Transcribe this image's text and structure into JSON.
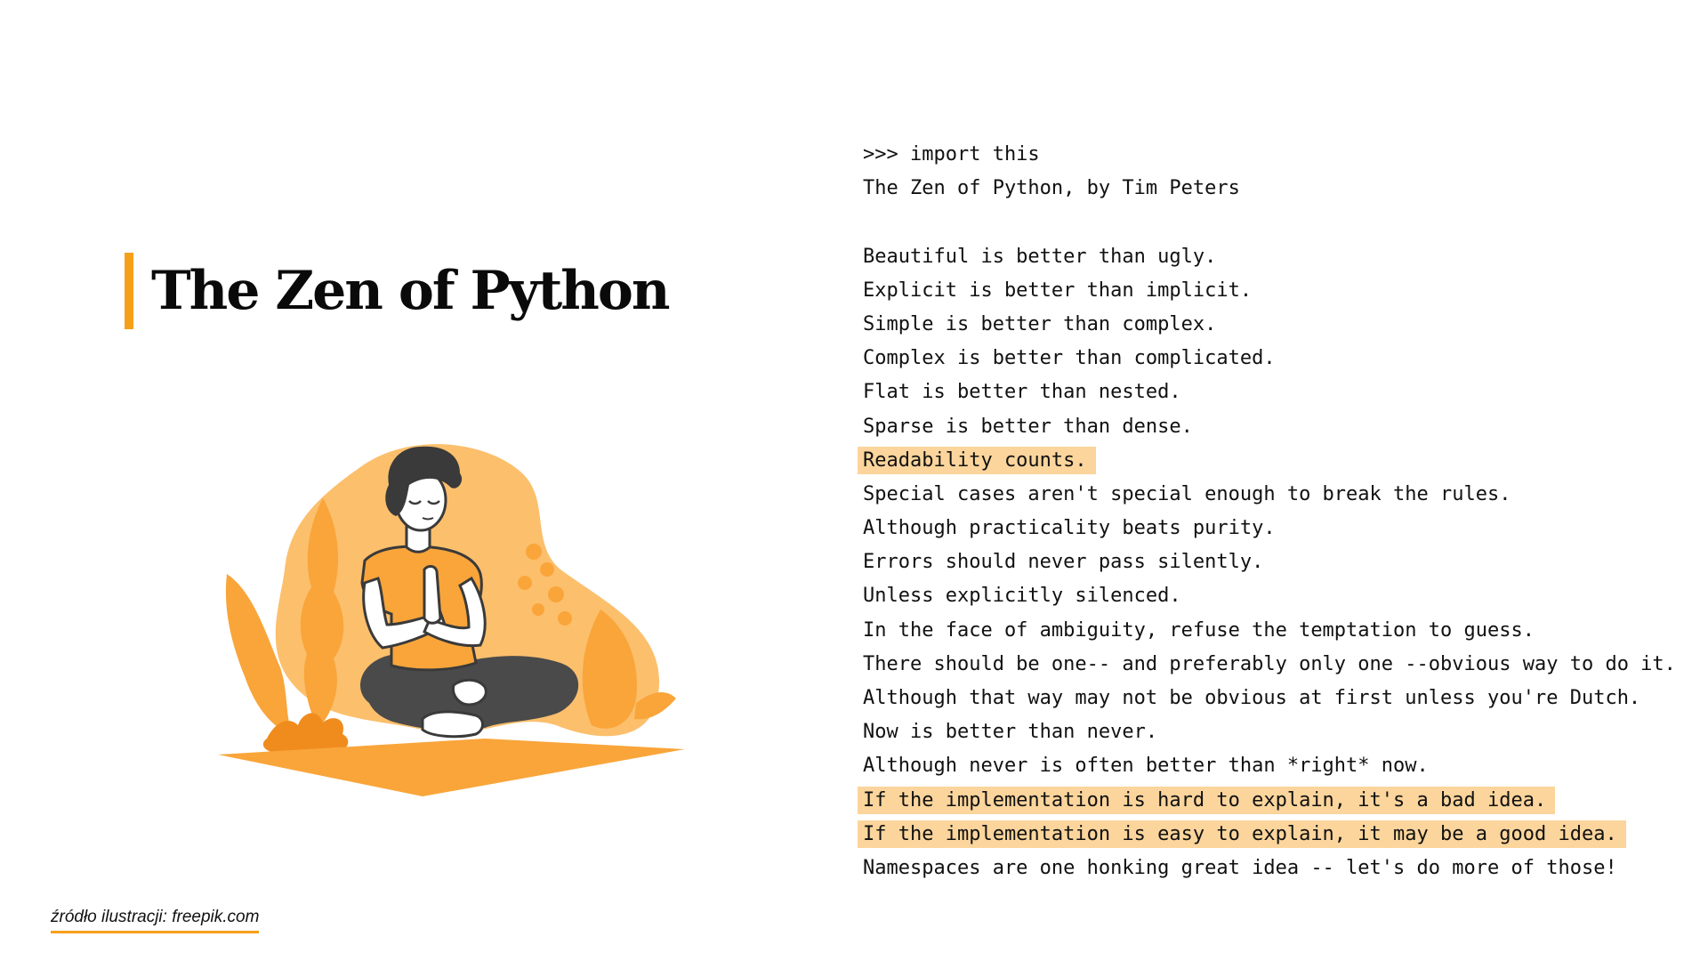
{
  "title": "The Zen of Python",
  "accent_color": "#f6a01a",
  "highlight_color": "#fbd59c",
  "illustration": {
    "subject": "person meditating cross-legged on an orange mat with plants and a blob background",
    "icon_name": "meditation-illustration"
  },
  "code": {
    "lines": [
      {
        "text": ">>> import this",
        "highlight": false
      },
      {
        "text": "The Zen of Python, by Tim Peters",
        "highlight": false
      },
      {
        "text": "",
        "highlight": false
      },
      {
        "text": "Beautiful is better than ugly.",
        "highlight": false
      },
      {
        "text": "Explicit is better than implicit.",
        "highlight": false
      },
      {
        "text": "Simple is better than complex.",
        "highlight": false
      },
      {
        "text": "Complex is better than complicated.",
        "highlight": false
      },
      {
        "text": "Flat is better than nested.",
        "highlight": false
      },
      {
        "text": "Sparse is better than dense.",
        "highlight": false
      },
      {
        "text": "Readability counts.",
        "highlight": true
      },
      {
        "text": "Special cases aren't special enough to break the rules.",
        "highlight": false
      },
      {
        "text": "Although practicality beats purity.",
        "highlight": false
      },
      {
        "text": "Errors should never pass silently.",
        "highlight": false
      },
      {
        "text": "Unless explicitly silenced.",
        "highlight": false
      },
      {
        "text": "In the face of ambiguity, refuse the temptation to guess.",
        "highlight": false
      },
      {
        "text": "There should be one-- and preferably only one --obvious way to do it.",
        "highlight": false
      },
      {
        "text": "Although that way may not be obvious at first unless you're Dutch.",
        "highlight": false
      },
      {
        "text": "Now is better than never.",
        "highlight": false
      },
      {
        "text": "Although never is often better than *right* now.",
        "highlight": false
      },
      {
        "text": "If the implementation is hard to explain, it's a bad idea.",
        "highlight": true
      },
      {
        "text": "If the implementation is easy to explain, it may be a good idea.",
        "highlight": true
      },
      {
        "text": "Namespaces are one honking great idea -- let's do more of those!",
        "highlight": false
      }
    ]
  },
  "source_note": "źródło ilustracji: freepik.com"
}
